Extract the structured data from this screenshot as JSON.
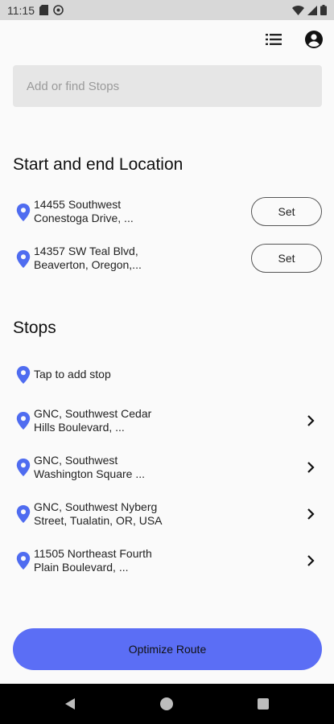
{
  "status_bar": {
    "time": "11:15",
    "icons": [
      "sd-card-icon",
      "vpn-circle-icon",
      "wifi-icon",
      "signal-icon",
      "battery-icon"
    ]
  },
  "toolbar": {
    "list_icon": "list-icon",
    "account_icon": "account-circle-icon"
  },
  "search": {
    "placeholder": "Add or find Stops",
    "value": ""
  },
  "start_end": {
    "title": "Start and end Location",
    "items": [
      {
        "line1": "14455 Southwest",
        "line2": "Conestoga Drive, ...",
        "button": "Set"
      },
      {
        "line1": "14357 SW Teal Blvd,",
        "line2": "Beaverton, Oregon,...",
        "button": "Set"
      }
    ]
  },
  "stops": {
    "title": "Stops",
    "add_label": "Tap to add stop",
    "items": [
      {
        "line1": "GNC, Southwest Cedar",
        "line2": "Hills Boulevard, ..."
      },
      {
        "line1": "GNC, Southwest",
        "line2": "Washington Square ..."
      },
      {
        "line1": "GNC, Southwest Nyberg",
        "line2": "Street, Tualatin, OR, USA"
      },
      {
        "line1": "11505 Northeast Fourth",
        "line2": "Plain Boulevard, ..."
      }
    ]
  },
  "actions": {
    "optimize_label": "Optimize Route"
  },
  "colors": {
    "accent": "#5b6ef5",
    "pin": "#4f6cf0",
    "status_bar_bg": "#d8d8d8",
    "nav_bar_bg": "#000000"
  }
}
